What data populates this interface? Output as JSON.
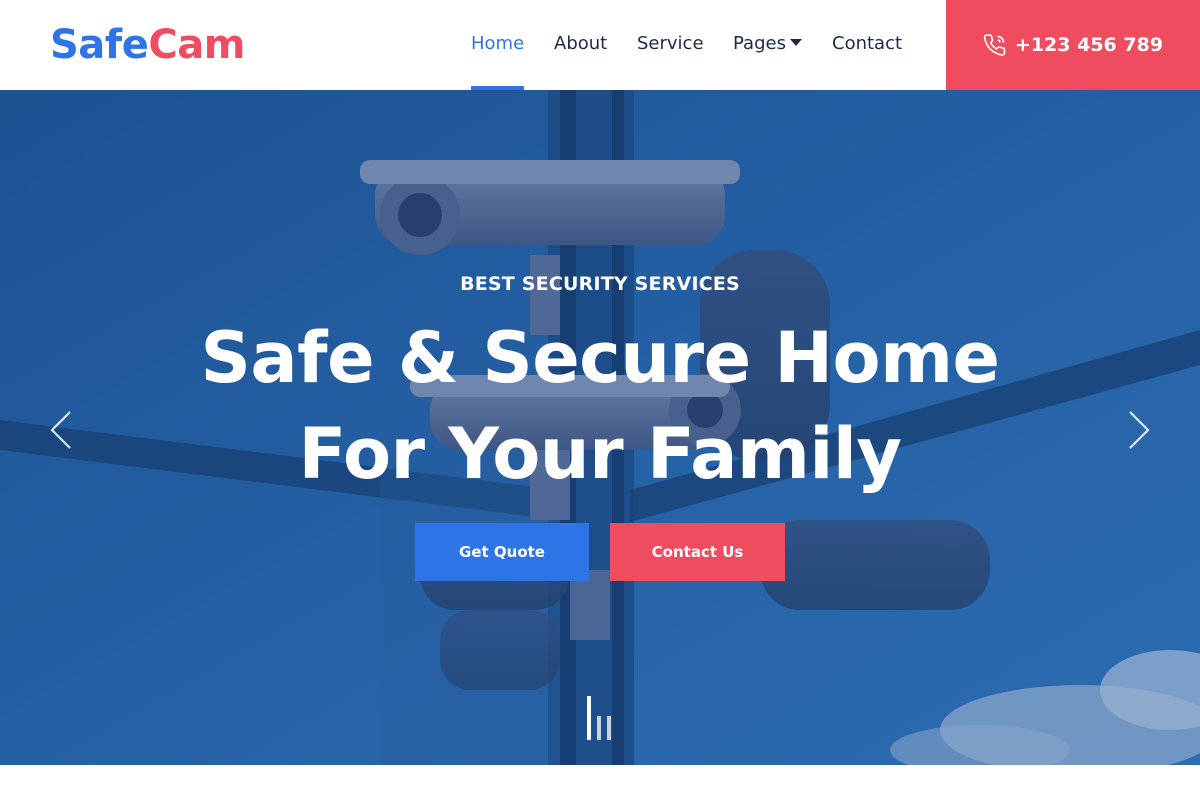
{
  "brand": {
    "part1": "Safe",
    "part2": "Cam"
  },
  "nav": {
    "items": [
      {
        "label": "Home",
        "active": true
      },
      {
        "label": "About"
      },
      {
        "label": "Service"
      },
      {
        "label": "Pages",
        "dropdown": true
      },
      {
        "label": "Contact"
      }
    ],
    "phone": "+123 456 789"
  },
  "hero": {
    "eyebrow": "BEST SECURITY SERVICES",
    "headline_line1": "Safe & Secure Home",
    "headline_line2": "For Your Family",
    "primary_button": "Get Quote",
    "secondary_button": "Contact Us",
    "active_slide": 1,
    "slide_count": 3
  },
  "icons": {
    "phone": "phone-icon",
    "prev": "chevron-left-icon",
    "next": "chevron-right-icon",
    "dropdown": "caret-down-icon"
  },
  "colors": {
    "primary": "#2f74e6",
    "accent": "#f04c5f",
    "text_dark": "#1c2a44",
    "hero_overlay": "#1f5a9c"
  }
}
